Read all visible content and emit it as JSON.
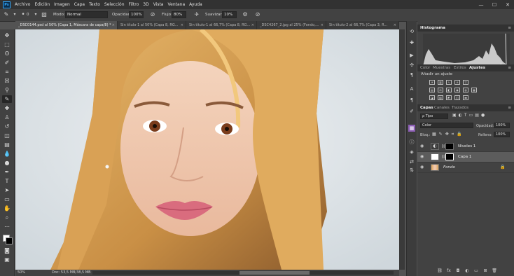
{
  "app": {
    "logo": "Ps"
  },
  "menu": [
    "Archivo",
    "Edición",
    "Imagen",
    "Capa",
    "Texto",
    "Selección",
    "Filtro",
    "3D",
    "Vista",
    "Ventana",
    "Ayuda"
  ],
  "window_controls": {
    "minimize": "—",
    "maximize": "☐",
    "close": "✕"
  },
  "options": {
    "brush_size": "0",
    "mode_label": "Modo:",
    "mode_value": "Normal",
    "opacity_label": "Opacidad:",
    "opacity_value": "100%",
    "flow_label": "Flujo:",
    "flow_value": "80%",
    "smooth_label": "Suavizar:",
    "smooth_value": "10%"
  },
  "tabs": [
    {
      "label": "_DSC0144.psd al 50% (Capa 1, Máscara de capa/8) *",
      "close": "×"
    },
    {
      "label": "Sin título-1 al 50% (Capa 8, RG...",
      "close": "×"
    },
    {
      "label": "Sin título-1 al 66,7% (Capa 8, RG...",
      "close": "×"
    },
    {
      "label": "_DSC4267_2.jpg al 25% (Fondo,...",
      "close": "×"
    },
    {
      "label": "Sin título-2 al 66,7% (Capa 3, R...",
      "close": "×"
    }
  ],
  "status": {
    "zoom": "50%",
    "doc": "Doc: 53,5 MB/38,5 MB",
    "arrow": "›"
  },
  "histogram": {
    "title": "Histograma"
  },
  "adjust_panel": {
    "tabs": [
      "Color",
      "Muestras",
      "Estilos",
      "Ajustes"
    ],
    "active_tab": "Ajustes",
    "title": "Añadir un ajuste"
  },
  "layers_panel": {
    "tabs": [
      "Capas",
      "Canales",
      "Trazados"
    ],
    "active_tab": "Capas",
    "filter_kind": "ρ Tipo",
    "blend_mode": "Color",
    "opacity_label": "Opacidad:",
    "opacity_value": "100%",
    "lock_label": "Bloq.:",
    "fill_label": "Relleno:",
    "fill_value": "100%",
    "layers": [
      {
        "name": "Niveles 1",
        "type": "adjustment",
        "visible": true
      },
      {
        "name": "Capa 1",
        "type": "masked",
        "visible": true,
        "selected": true
      },
      {
        "name": "Fondo",
        "type": "background",
        "visible": true,
        "locked": true
      }
    ]
  },
  "colors": {
    "menubar": "#323232",
    "panel": "#424242",
    "canvas_bg": "#dde4e8",
    "accent": "#31a8ff",
    "hair": "#d9a55a",
    "lips": "#d96c7e",
    "skin": "#f0c8ac"
  }
}
